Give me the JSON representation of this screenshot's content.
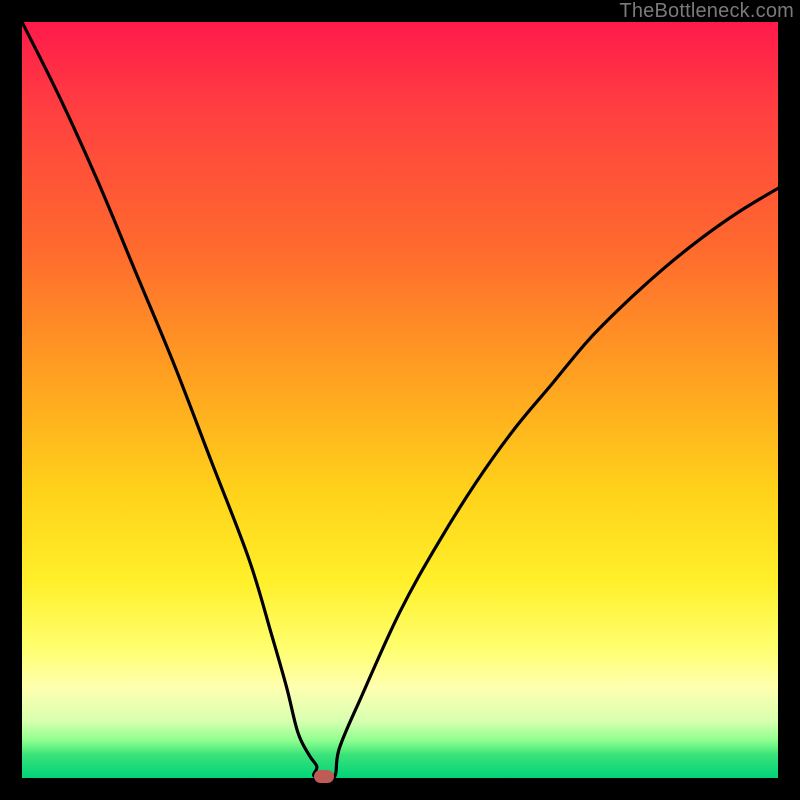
{
  "watermark": {
    "text": "TheBottleneck.com"
  },
  "colors": {
    "curve_stroke": "#000000",
    "dot_fill": "#c05a55",
    "frame_bg": "#000000"
  },
  "chart_data": {
    "type": "line",
    "title": "",
    "xlabel": "",
    "ylabel": "",
    "xlim": [
      0,
      100
    ],
    "ylim": [
      0,
      100
    ],
    "x": [
      0,
      5,
      10,
      15,
      20,
      25,
      30,
      33,
      35,
      36.5,
      38,
      39,
      40,
      42,
      45,
      50,
      55,
      60,
      65,
      70,
      75,
      80,
      85,
      90,
      95,
      100
    ],
    "values": [
      100,
      90,
      79,
      67,
      55,
      42,
      29,
      19,
      12,
      6,
      3,
      1.5,
      0,
      4,
      11,
      22,
      31,
      39,
      46,
      52,
      58,
      63,
      67.5,
      71.5,
      75,
      78
    ],
    "series": [
      {
        "name": "bottleneck-curve",
        "values_ref": "values"
      }
    ],
    "marker": {
      "x": 40,
      "y": 0,
      "label": "optimal-point"
    }
  }
}
